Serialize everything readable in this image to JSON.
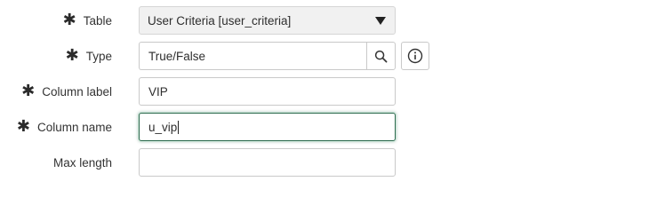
{
  "form": {
    "table": {
      "label": "Table",
      "value": "User Criteria [user_criteria]"
    },
    "type": {
      "label": "Type",
      "value": "True/False"
    },
    "column_label": {
      "label": "Column label",
      "value": "VIP"
    },
    "column_name": {
      "label": "Column name",
      "value": "u_vip"
    },
    "max_length": {
      "label": "Max length",
      "value": ""
    }
  },
  "icons": {
    "required": "asterisk-icon",
    "dropdown": "caret-down-icon",
    "search": "search-icon",
    "info": "info-icon"
  },
  "colors": {
    "focus_border": "#2e6b4f",
    "select_background": "#f1f1f1"
  }
}
